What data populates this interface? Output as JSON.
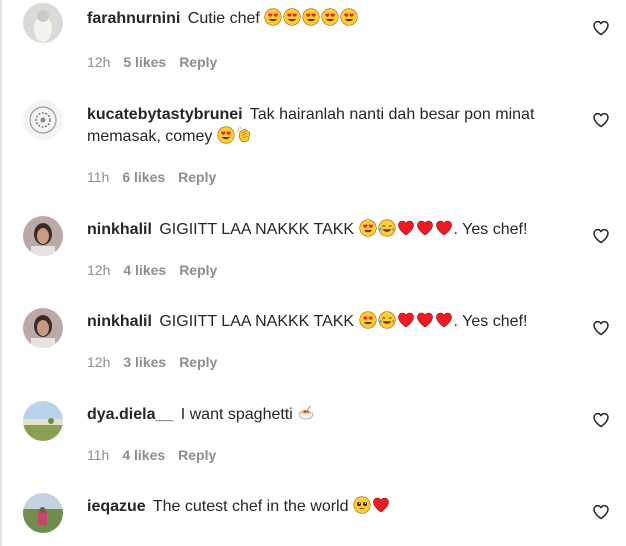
{
  "comments": [
    {
      "username": "farahnurnini",
      "text": "Cutie chef",
      "emojis": [
        "heart-eyes",
        "heart-eyes",
        "heart-eyes",
        "heart-eyes",
        "heart-eyes"
      ],
      "time": "12h",
      "likes": "5 likes",
      "reply": "Reply"
    },
    {
      "username": "kucatebytastybrunei",
      "text": "Tak hairanlah nanti dah besar pon minat memasak, comey",
      "emojis": [
        "heart-eyes",
        "clapping-hands"
      ],
      "time": "11h",
      "likes": "6 likes",
      "reply": "Reply"
    },
    {
      "username": "ninkhalil",
      "text": "GIGIITT LAA NAKKK TAKK",
      "emojis": [
        "heart-eyes",
        "tears-of-joy",
        "red-heart",
        "red-heart",
        "red-heart"
      ],
      "text_after": ". Yes chef!",
      "time": "12h",
      "likes": "4 likes",
      "reply": "Reply"
    },
    {
      "username": "ninkhalil",
      "text": "GIGIITT LAA NAKKK TAKK",
      "emojis": [
        "heart-eyes",
        "tears-of-joy",
        "red-heart",
        "red-heart",
        "red-heart"
      ],
      "text_after": ". Yes chef!",
      "time": "12h",
      "likes": "3 likes",
      "reply": "Reply"
    },
    {
      "username": "dya.diela__",
      "text": "I want spaghetti",
      "emojis": [
        "spaghetti"
      ],
      "time": "11h",
      "likes": "4 likes",
      "reply": "Reply"
    },
    {
      "username": "ieqazue",
      "text": "The cutest chef in the world",
      "emojis": [
        "pleading-face",
        "red-heart"
      ],
      "time": "",
      "likes": "",
      "reply": ""
    }
  ],
  "colors": {
    "text": "#262626",
    "meta": "#8e8e8e",
    "heart": "#ed1c24",
    "emoji_face": "#ffcc33"
  },
  "icons": {
    "like": "heart-outline-icon"
  }
}
